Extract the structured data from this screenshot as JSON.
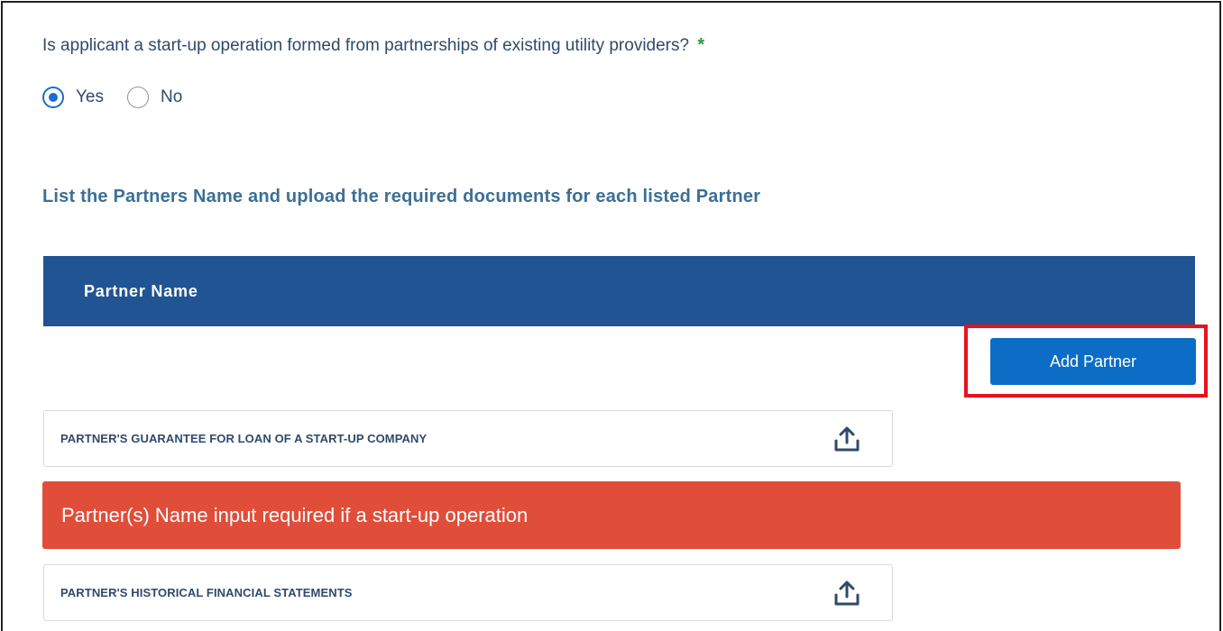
{
  "question": {
    "text": "Is applicant a start-up operation formed from partnerships of existing utility providers?",
    "required_marker": "*",
    "options": [
      {
        "label": "Yes",
        "selected": true
      },
      {
        "label": "No",
        "selected": false
      }
    ]
  },
  "section_title": "List the Partners Name and upload the required documents for each listed Partner",
  "table": {
    "columns": [
      "Partner Name"
    ],
    "header_color": "#205493"
  },
  "add_partner_button": "Add Partner",
  "documents": [
    {
      "label": "PARTNER'S GUARANTEE FOR LOAN OF A START-UP COMPANY",
      "icon": "upload-icon"
    },
    {
      "label": "PARTNER'S HISTORICAL FINANCIAL STATEMENTS",
      "icon": "upload-icon"
    }
  ],
  "error": {
    "text": "Partner(s) Name input required if a start-up operation",
    "color": "#e04e39"
  },
  "colors": {
    "accent": "#0b6dc5",
    "highlight": "#e8121d",
    "required": "#2e9a3e"
  }
}
